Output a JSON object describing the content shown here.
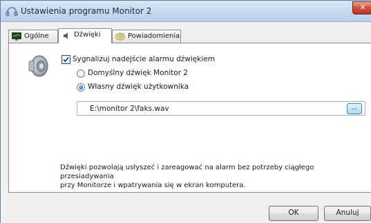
{
  "window": {
    "title": "Ustawienia programu Monitor 2",
    "close_label": "✕"
  },
  "tabs": [
    {
      "label": "Ogólne",
      "icon": "monitor-icon",
      "active": false
    },
    {
      "label": "Dźwięki",
      "icon": "speaker-icon",
      "active": true
    },
    {
      "label": "Powiadomienia",
      "icon": "notification-icon",
      "active": false
    }
  ],
  "sound": {
    "signal_checkbox_label": "Sygnalizuj nadejście alarmu dźwiękiem",
    "signal_checked": true,
    "default_sound_label": "Domyślny dźwięk Monitor 2",
    "custom_sound_label": "Własny dźwięk użytkownika",
    "selected": "custom",
    "path_value": "E:\\monitor 2\\faks.wav",
    "browse_label": "...",
    "description_line1": "Dźwięki pozwolają usłyszeć i zareagować na alarm bez potrzeby ciągłego przesiadywania",
    "description_line2": "przy Monitorze i wpatrywania się w ekran komputera."
  },
  "buttons": {
    "ok_label": "OK",
    "cancel_label": "Anuluj"
  },
  "colors": {
    "titlebar": "#c5d8ef",
    "close_button": "#c8432e",
    "panel_background": "#ffffff",
    "dialog_background": "#f0f0f0"
  }
}
